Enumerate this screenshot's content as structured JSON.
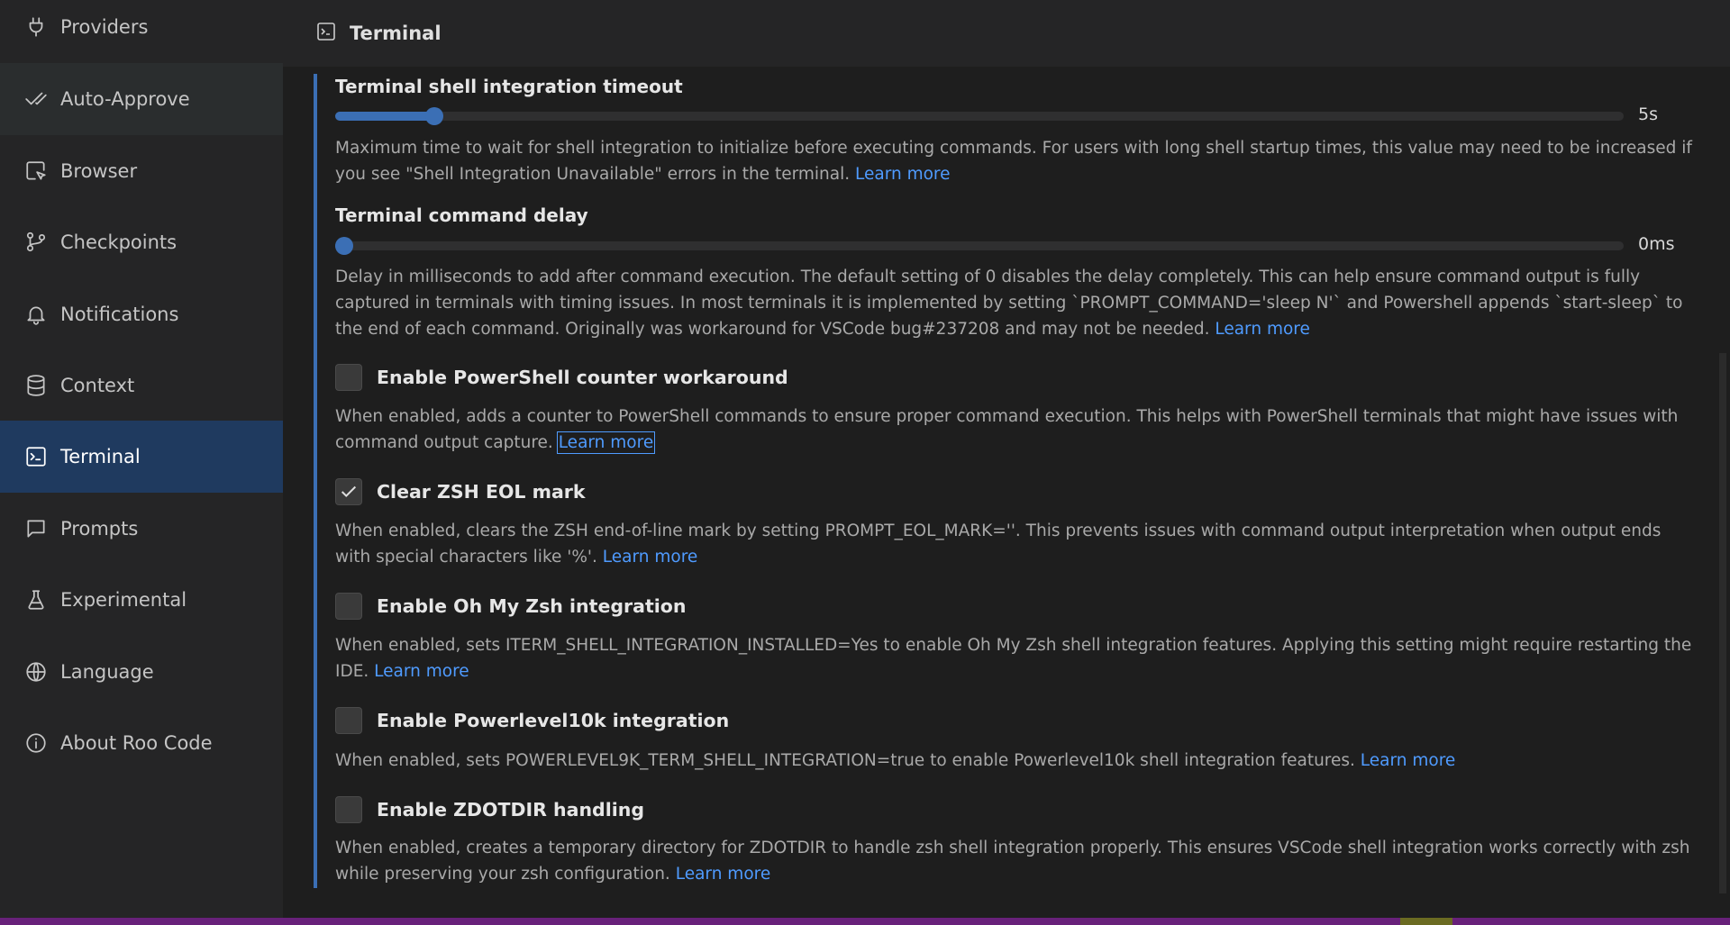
{
  "sidebar": {
    "items": [
      {
        "label": "Providers"
      },
      {
        "label": "Auto-Approve"
      },
      {
        "label": "Browser"
      },
      {
        "label": "Checkpoints"
      },
      {
        "label": "Notifications"
      },
      {
        "label": "Context"
      },
      {
        "label": "Terminal"
      },
      {
        "label": "Prompts"
      },
      {
        "label": "Experimental"
      },
      {
        "label": "Language"
      },
      {
        "label": "About Roo Code"
      }
    ]
  },
  "header": {
    "title": "Terminal"
  },
  "settings": {
    "shell_timeout": {
      "title": "Terminal shell integration timeout",
      "value_label": "5s",
      "fraction": 0.07,
      "desc": "Maximum time to wait for shell integration to initialize before executing commands. For users with long shell startup times, this value may need to be increased if you see \"Shell Integration Unavailable\" errors in the terminal.",
      "link": "Learn more"
    },
    "command_delay": {
      "title": "Terminal command delay",
      "value_label": "0ms",
      "fraction": 0.0,
      "desc": "Delay in milliseconds to add after command execution. The default setting of 0 disables the delay completely. This can help ensure command output is fully captured in terminals with timing issues. In most terminals it is implemented by setting `PROMPT_COMMAND='sleep N'` and Powershell appends `start-sleep` to the end of each command. Originally was workaround for VSCode bug#237208 and may not be needed.",
      "link": "Learn more"
    },
    "powershell_counter": {
      "label": "Enable PowerShell counter workaround",
      "checked": false,
      "desc": "When enabled, adds a counter to PowerShell commands to ensure proper command execution. This helps with PowerShell terminals that might have issues with command output capture.",
      "link": "Learn more"
    },
    "zsh_eol": {
      "label": "Clear ZSH EOL mark",
      "checked": true,
      "desc": "When enabled, clears the ZSH end-of-line mark by setting PROMPT_EOL_MARK=''. This prevents issues with command output interpretation when output ends with special characters like '%'.",
      "link": "Learn more"
    },
    "oh_my_zsh": {
      "label": "Enable Oh My Zsh integration",
      "checked": false,
      "desc": "When enabled, sets ITERM_SHELL_INTEGRATION_INSTALLED=Yes to enable Oh My Zsh shell integration features. Applying this setting might require restarting the IDE.",
      "link": "Learn more"
    },
    "powerlevel10k": {
      "label": "Enable Powerlevel10k integration",
      "checked": false,
      "desc": "When enabled, sets POWERLEVEL9K_TERM_SHELL_INTEGRATION=true to enable Powerlevel10k shell integration features.",
      "link": "Learn more"
    },
    "zdotdir": {
      "label": "Enable ZDOTDIR handling",
      "checked": false,
      "desc": "When enabled, creates a temporary directory for ZDOTDIR to handle zsh shell integration properly. This ensures VSCode shell integration works correctly with zsh while preserving your zsh configuration.",
      "link": "Learn more"
    }
  },
  "colors": {
    "accent": "#3b6fb5",
    "link": "#4f9bff",
    "active_bg": "#1f3a5f",
    "statusbar": "#68217a"
  },
  "icons": [
    "plug-icon",
    "check-double-icon",
    "browser-pointer-icon",
    "git-branch-icon",
    "bell-icon",
    "database-icon",
    "terminal-icon",
    "chat-bubble-icon",
    "flask-icon",
    "globe-icon",
    "info-icon"
  ]
}
